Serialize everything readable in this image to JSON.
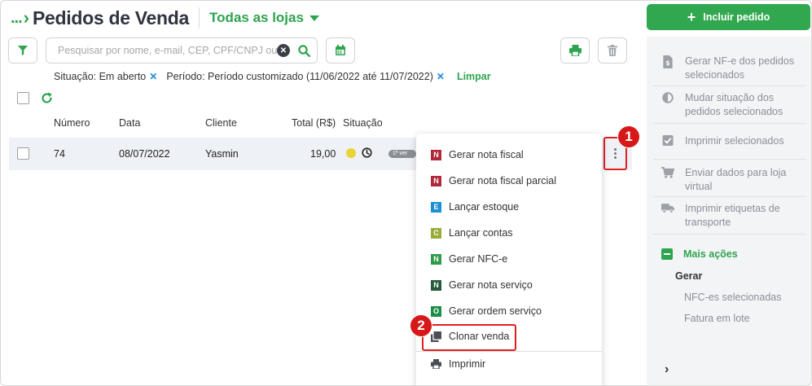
{
  "header": {
    "breadcrumb": "...",
    "title": "Pedidos de Venda",
    "store_selector": "Todas as lojas"
  },
  "search": {
    "placeholder": "Pesquisar por nome, e-mail, CEP, CPF/CNPJ ou"
  },
  "filters": {
    "situacao": "Situação: Em aberto",
    "periodo": "Período: Período customizado (11/06/2022 até 11/07/2022)",
    "clear_label": "Limpar"
  },
  "table": {
    "columns": [
      "Número",
      "Data",
      "Cliente",
      "Total (R$)",
      "Situação"
    ],
    "rows": [
      {
        "numero": "74",
        "data": "08/07/2022",
        "cliente": "Yasmin",
        "total": "19,00",
        "tag": "1ª ver"
      }
    ]
  },
  "callouts": {
    "one": "1",
    "two": "2"
  },
  "menu": {
    "items": [
      {
        "label": "Gerar nota fiscal",
        "icon_letter": "N",
        "color": "#b0283c"
      },
      {
        "label": "Gerar nota fiscal parcial",
        "icon_letter": "N",
        "color": "#b0283c"
      },
      {
        "label": "Lançar estoque",
        "icon_letter": "E",
        "color": "#1b8fd2"
      },
      {
        "label": "Lançar contas",
        "icon_letter": "C",
        "color": "#9aab3a"
      },
      {
        "label": "Gerar NFC-e",
        "icon_letter": "N",
        "color": "#2f9c48"
      },
      {
        "label": "Gerar nota serviço",
        "icon_letter": "N",
        "color": "#255a3a"
      },
      {
        "label": "Gerar ordem serviço",
        "icon_letter": "O",
        "color": "#1c8e4a"
      },
      {
        "label": "Clonar venda",
        "icon_letter": "",
        "color": "#4a4f57"
      },
      {
        "label": "Imprimir",
        "icon_letter": "",
        "color": "#4a4f57"
      }
    ]
  },
  "sidebar": {
    "include_button": "Incluir pedido",
    "actions": [
      {
        "label1": "Gerar NF-e dos pedidos",
        "label2": "selecionados",
        "icon": "invoice-dollar-icon"
      },
      {
        "label1": "Mudar situação dos",
        "label2": "pedidos selecionados",
        "icon": "half-circle-icon"
      },
      {
        "label1": "Imprimir selecionados",
        "label2": "",
        "icon": "checkbox-checked-icon"
      },
      {
        "label1": "Enviar dados para loja",
        "label2": "virtual",
        "icon": "cart-icon"
      },
      {
        "label1": "Imprimir etiquetas de",
        "label2": "transporte",
        "icon": "truck-icon"
      }
    ],
    "more_actions": "Mais ações",
    "gerar_heading": "Gerar",
    "gerar_items": [
      "NFC-es selecionadas",
      "Fatura em lote"
    ]
  },
  "colors": {
    "accent": "#2ea44f",
    "highlight": "#e02020"
  }
}
